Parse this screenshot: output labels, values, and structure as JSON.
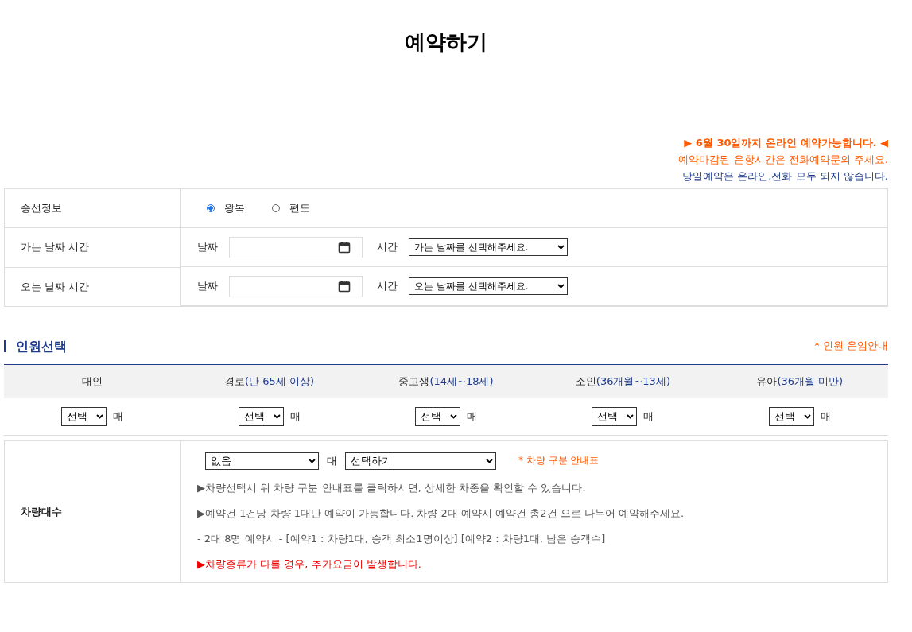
{
  "title": "예약하기",
  "notices": [
    {
      "kind": "highlight",
      "text": "▶ 6월 30일까지 온라인 예약가능합니다. ◀"
    },
    {
      "kind": "warning",
      "text": "예약마감된 운항시간은 전화예약문의 주세요."
    },
    {
      "kind": "info",
      "text": "당일예약은 온라인,전화 모두 되지 않습니다."
    }
  ],
  "trip": {
    "label": "승선정보",
    "options": [
      {
        "label": "왕복",
        "selected": true
      },
      {
        "label": "편도",
        "selected": false
      }
    ]
  },
  "dates": [
    {
      "label": "가는 날짜 시간",
      "date_label": "날짜",
      "time_label": "시간",
      "time_value": "가는 날짜를 선택해주세요."
    },
    {
      "label": "오는 날짜 시간",
      "date_label": "날짜",
      "time_label": "시간",
      "time_value": "오는 날짜를 선택해주세요."
    }
  ],
  "passengers": {
    "title": "인원선택",
    "guide_link": "* 인원 운임안내",
    "columns": [
      {
        "name": "대인",
        "value": "선택",
        "unit": "매"
      },
      {
        "name": "경로",
        "note": "(만 65세 이상)",
        "value": "선택",
        "unit": "매"
      },
      {
        "name": "중고생",
        "note": "(14세~18세)",
        "value": "선택",
        "unit": "매"
      },
      {
        "name": "소인",
        "note": "(36개월~13세)",
        "value": "선택",
        "unit": "매"
      },
      {
        "name": "유아",
        "note": "(36개월 미만)",
        "value": "선택",
        "unit": "매"
      }
    ]
  },
  "vehicle": {
    "label": "차량대수",
    "count_value": "없음",
    "unit": "대",
    "type_value": "선택하기",
    "guide_link": "* 차량 구분 안내표",
    "notes": [
      {
        "kind": "plain",
        "text": "▶차량선택시 위 차량 구분 안내표를 클릭하시면, 상세한 차종을 확인할 수 있습니다."
      },
      {
        "kind": "plain",
        "text": "▶예약건 1건당 차량 1대만 예약이 가능합니다. 차량 2대 예약시 예약건 총2건 으로 나누어 예약해주세요."
      },
      {
        "kind": "plain",
        "text": "- 2대 8명 예약시 - [예약1 : 차량1대, 승객 최소1명이상] [예약2 : 차량1대, 남은 승객수]"
      },
      {
        "kind": "warning",
        "text": "▶차량종류가 다를 경우, 추가요금이 발생합니다."
      }
    ]
  }
}
